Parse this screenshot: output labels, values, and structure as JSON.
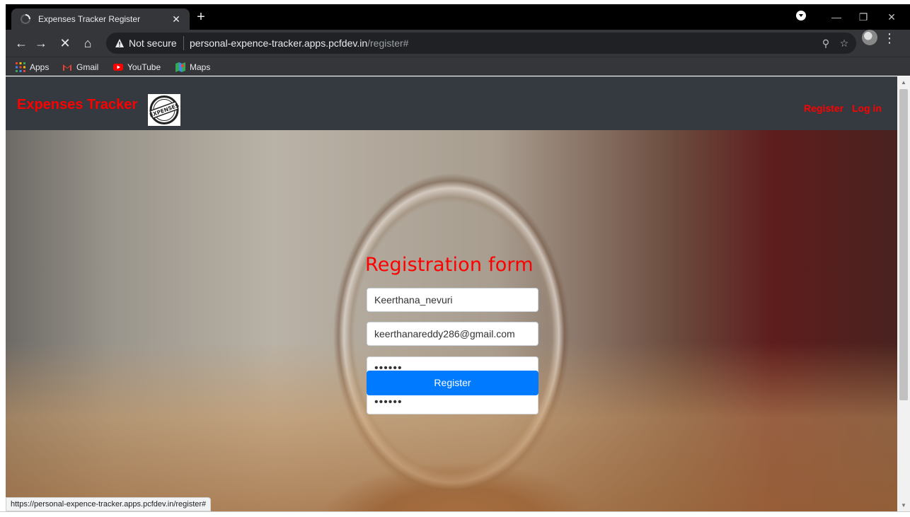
{
  "browser": {
    "tab_title": "Expenses Tracker Register",
    "not_secure_label": "Not secure",
    "url_host": "personal-expence-tracker.apps.pcfdev.in",
    "url_path": "/register#",
    "bookmarks": [
      {
        "label": "Apps",
        "icon": "apps-grid-icon"
      },
      {
        "label": "Gmail",
        "icon": "gmail-icon"
      },
      {
        "label": "YouTube",
        "icon": "youtube-icon"
      },
      {
        "label": "Maps",
        "icon": "maps-icon"
      }
    ],
    "status_url": "https://personal-expence-tracker.apps.pcfdev.in/register#"
  },
  "navbar": {
    "brand": "Expenses Tracker",
    "logo_text": "EXPENSES",
    "links": [
      "Register",
      "Log in"
    ]
  },
  "form": {
    "title": "Registration form",
    "username_value": "Keerthana_nevuri",
    "email_value": "keerthanareddy286@gmail.com",
    "password_value": "••••••",
    "confirm_password_value": "••••••",
    "submit_label": "Register"
  },
  "colors": {
    "brand_red": "#ff0000",
    "navbar_bg": "#343a40",
    "button_blue": "#007bff"
  }
}
